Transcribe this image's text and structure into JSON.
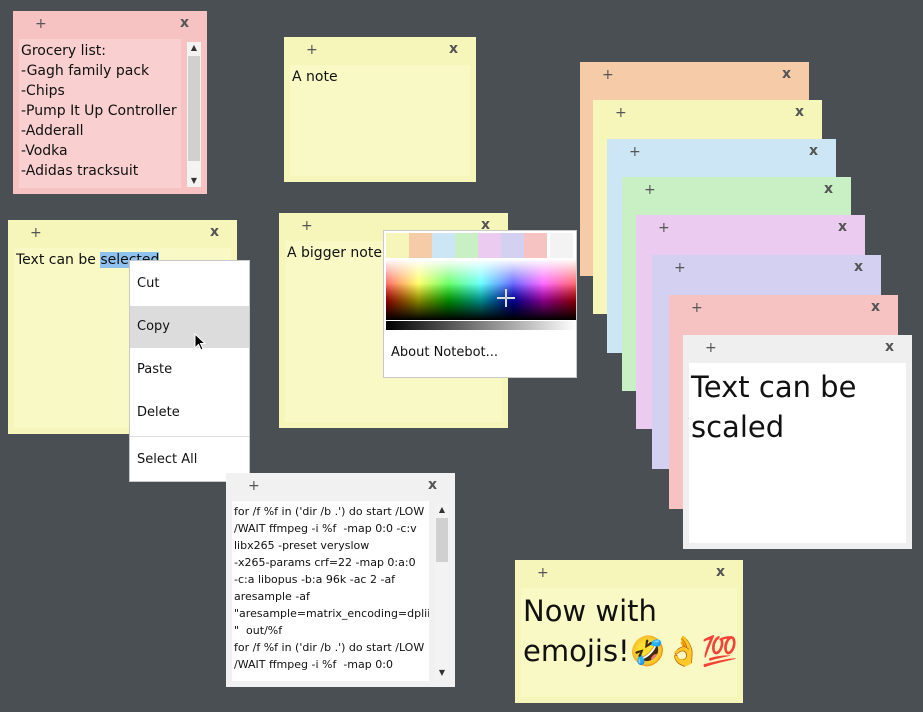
{
  "controls": {
    "new_glyph": "+",
    "close_glyph": "x"
  },
  "grocery": {
    "lines": [
      "Grocery list:",
      "-Gagh family pack",
      "-Chips",
      "-Pump It Up Controller",
      "-Adderall",
      "-Vodka",
      "-Adidas tracksuit"
    ],
    "color": "#f6c2c2"
  },
  "anote": {
    "text": "A note",
    "color": "#f6f6bb"
  },
  "selected_note": {
    "text_before": "Text can be ",
    "text_selected": "selected",
    "color": "#f6f6bb"
  },
  "context_menu": {
    "items": [
      "Cut",
      "Copy",
      "Paste",
      "Delete",
      "Select All"
    ],
    "highlighted": "Copy"
  },
  "bigger_note": {
    "text": "A bigger note",
    "color": "#f6f6bb"
  },
  "color_picker": {
    "swatches": [
      "#f6f6bb",
      "#f6cca8",
      "#cce6f5",
      "#c9f0c5",
      "#eccbf0",
      "#d4d0f2",
      "#f6c2c2",
      "#f3f3f3"
    ],
    "about_label": "About Notebot..."
  },
  "stack_colors": [
    "#f6cca8",
    "#f6f6bb",
    "#cce6f5",
    "#c9f0c5",
    "#eccbf0",
    "#d4d0f2",
    "#f6c2c2",
    "#f1f1f1"
  ],
  "scaled_note": {
    "line1": "Text can be",
    "line2": "scaled"
  },
  "code_note": {
    "lines": [
      "for /f %f in ('dir /b .') do start /LOW",
      "/WAIT ffmpeg -i %f  -map 0:0 -c:v",
      "libx265 -preset veryslow",
      "-x265-params crf=22 -map 0:a:0",
      "-c:a libopus -b:a 96k -ac 2 -af",
      "aresample -af",
      "\"aresample=matrix_encoding=dplii",
      "\"  out/%f",
      "",
      "for /f %f in ('dir /b .') do start /LOW",
      "/WAIT ffmpeg -i %f  -map 0:0"
    ]
  },
  "emoji_note": {
    "line1": "Now with",
    "line2": "emojis!🤣👌💯",
    "color": "#f6f6bb"
  }
}
